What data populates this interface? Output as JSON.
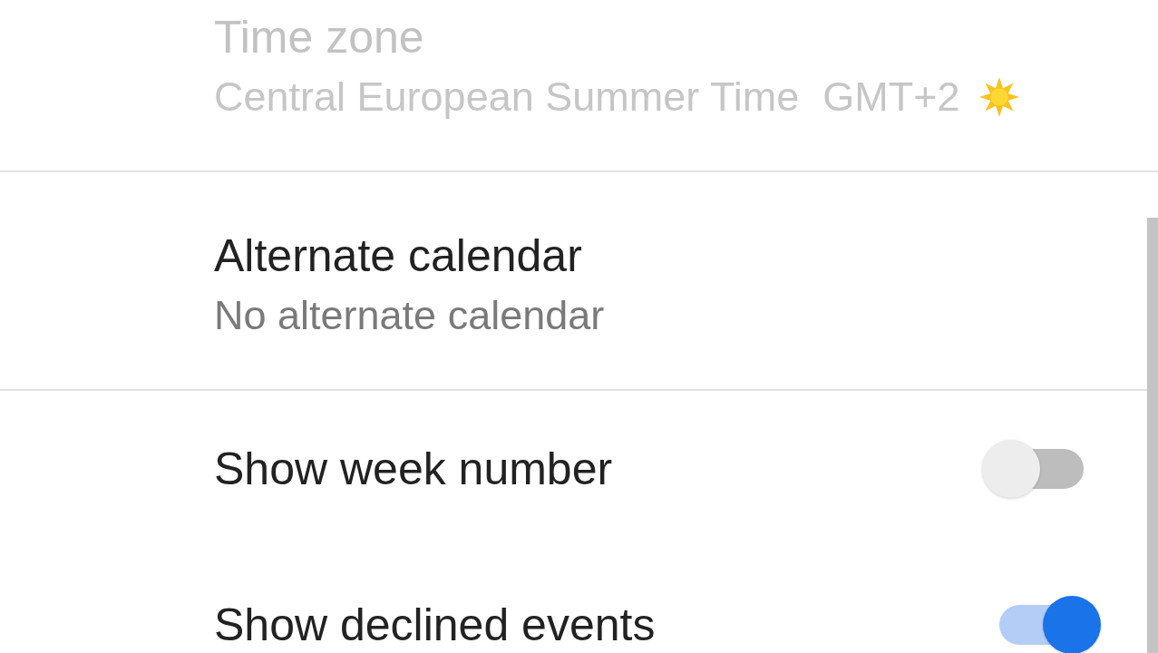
{
  "sections": [
    {
      "items": [
        {
          "kind": "timezone",
          "title": "Time zone",
          "value": "Central European Summer Time",
          "offset": "GMT+2",
          "daylight_saving": true,
          "disabled": true
        }
      ]
    },
    {
      "items": [
        {
          "kind": "value",
          "title": "Alternate calendar",
          "value": "No alternate calendar",
          "disabled": false
        }
      ]
    },
    {
      "items": [
        {
          "kind": "toggle",
          "title": "Show week number",
          "on": false,
          "disabled": false
        },
        {
          "kind": "toggle",
          "title": "Show declined events",
          "on": true,
          "disabled": false
        }
      ]
    }
  ]
}
